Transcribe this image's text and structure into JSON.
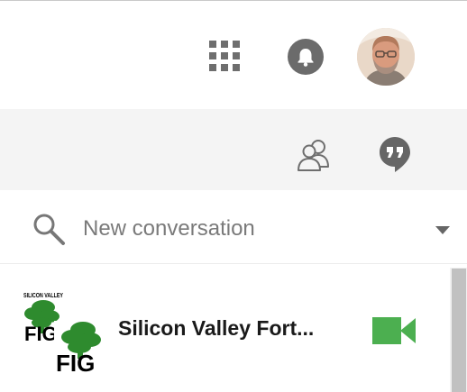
{
  "header": {
    "apps_icon": "apps-grid-icon",
    "notifications_icon": "bell-icon",
    "avatar_icon": "user-avatar"
  },
  "toolbar": {
    "contacts_icon": "people-icon",
    "hangouts_icon": "hangouts-quote-icon"
  },
  "search": {
    "placeholder": "New conversation",
    "value": "",
    "search_icon": "search-icon",
    "dropdown_icon": "chevron-down-icon"
  },
  "conversations": [
    {
      "title": "Silicon Valley Fort...",
      "avatar_text_top": "SILICON VALLEY",
      "avatar_text_bottom": "FIG",
      "action_icon": "video-call-icon"
    }
  ],
  "colors": {
    "icon_gray": "#6e6e6e",
    "toolbar_bg": "#f4f4f4",
    "video_green": "#4caf50",
    "fig_green": "#2e8b2e",
    "scroll_thumb": "#c1c1c1"
  }
}
